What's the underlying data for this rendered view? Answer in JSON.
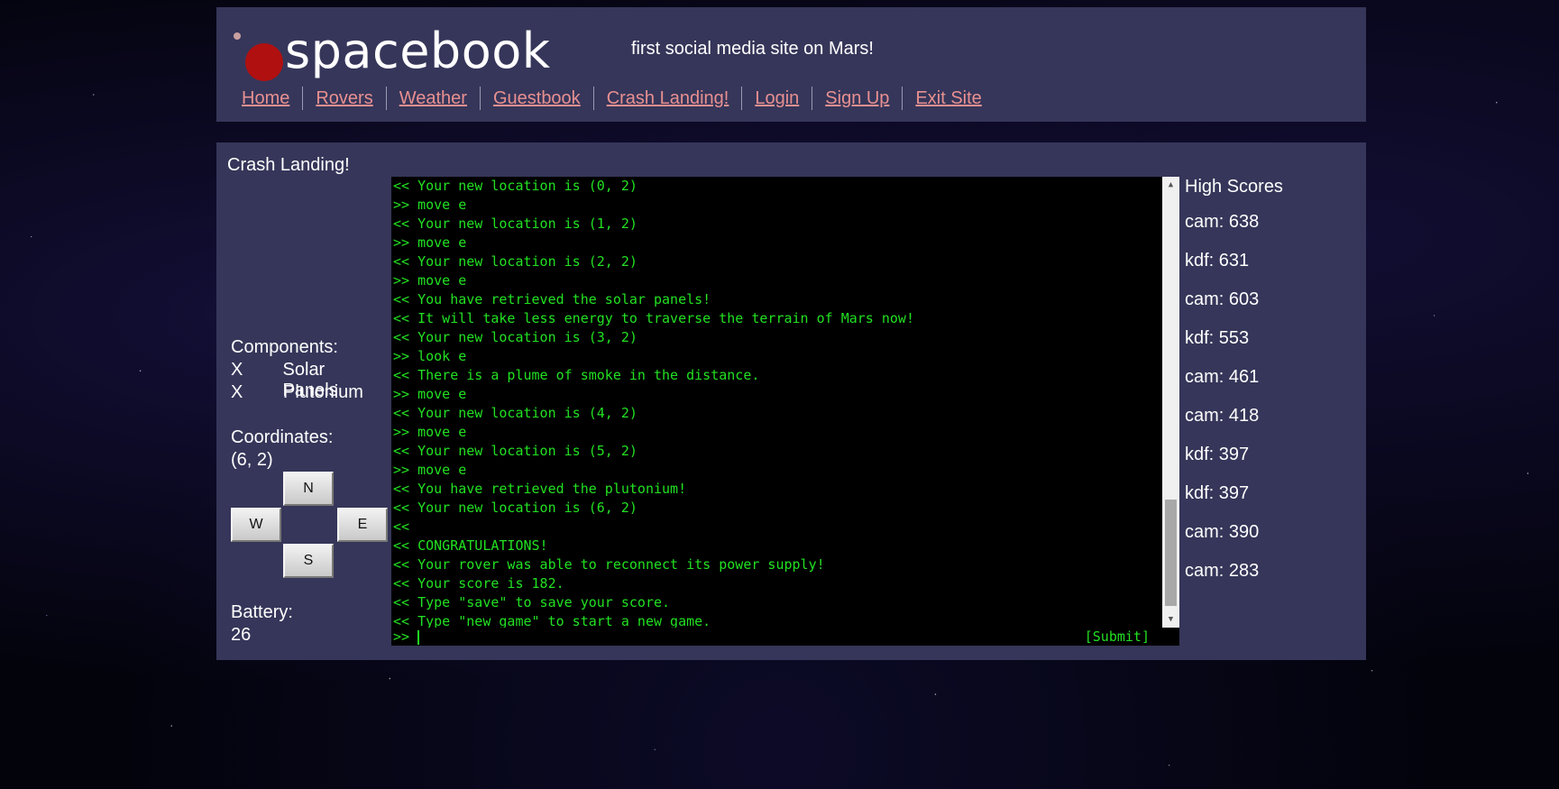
{
  "header": {
    "logo_text": "spacebook",
    "tagline": "first social media site on Mars!",
    "nav": [
      "Home",
      "Rovers",
      "Weather",
      "Guestbook",
      "Crash Landing!",
      "Login",
      "Sign Up",
      "Exit Site"
    ]
  },
  "game": {
    "title": "Crash Landing!",
    "components_label": "Components:",
    "components": [
      {
        "mark": "X",
        "name": "Solar Panels"
      },
      {
        "mark": "X",
        "name": "Plutonium"
      }
    ],
    "coordinates_label": "Coordinates:",
    "coordinates_value": "(6, 2)",
    "dpad": {
      "n": "N",
      "w": "W",
      "e": "E",
      "s": "S"
    },
    "battery_label": "Battery:",
    "battery_value": "26"
  },
  "terminal": {
    "lines": [
      "<< Your new location is (0, 2)",
      ">> move e",
      "<< Your new location is (1, 2)",
      ">> move e",
      "<< Your new location is (2, 2)",
      ">> move e",
      "<< You have retrieved the solar panels!",
      "<< It will take less energy to traverse the terrain of Mars now!",
      "<< Your new location is (3, 2)",
      ">> look e",
      "<< There is a plume of smoke in the distance.",
      ">> move e",
      "<< Your new location is (4, 2)",
      ">> move e",
      "<< Your new location is (5, 2)",
      ">> move e",
      "<< You have retrieved the plutonium!",
      "<< Your new location is (6, 2)",
      "<<",
      "<< CONGRATULATIONS!",
      "<< Your rover was able to reconnect its power supply!",
      "<< Your score is 182.",
      "<< Type \"save\" to save your score.",
      "<< Type \"new game\" to start a new game."
    ],
    "prompt": ">> ",
    "submit_label": "[Submit]"
  },
  "scores": {
    "title": "High Scores",
    "items": [
      "cam: 638",
      "kdf: 631",
      "cam: 603",
      "kdf: 553",
      "cam: 461",
      "cam: 418",
      "kdf: 397",
      "kdf: 397",
      "cam: 390",
      "cam: 283"
    ]
  }
}
